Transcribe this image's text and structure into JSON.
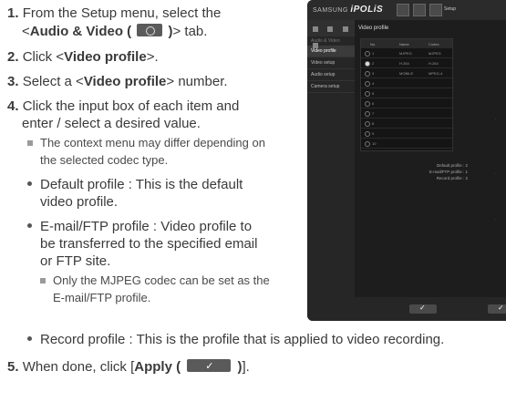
{
  "steps": [
    {
      "num": "1.",
      "pre": "From the Setup menu, select the",
      "line2_pre": "<",
      "bold": "Audio & Video (",
      "icon": "audio-video-icon",
      "bold_end": ")",
      "post": "> tab."
    },
    {
      "num": "2.",
      "pre": "Click <",
      "bold": "Video profile",
      "post": ">."
    },
    {
      "num": "3.",
      "pre": "Select a <",
      "bold": "Video profile",
      "post": "> number."
    },
    {
      "num": "4.",
      "line1": "Click the input box of each item and",
      "line2": "enter / select a desired value."
    },
    {
      "num": "5.",
      "pre": "When done, click [",
      "bold": "Apply (",
      "icon": "apply-check-icon",
      "bold_end": ")",
      "post": "]."
    }
  ],
  "notes": {
    "context_line1": "The context menu may differ depending on",
    "context_line2": "the selected codec type.",
    "mjpeg_line1": "Only the MJPEG codec can be set as the",
    "mjpeg_line2": "E-mail/FTP profile."
  },
  "bullets": {
    "default_line1": "Default profile : This is the default",
    "default_line2": "video profile.",
    "email_line1": "E-mail/FTP profile : Video profile to",
    "email_line2": "be transferred to the specified email",
    "email_line3": "or FTP site.",
    "record": "Record profile : This is the profile that is applied to video recording."
  },
  "screenshot": {
    "brand": "SAMSUNG",
    "product": "iPOLiS",
    "setup_label": "Setup",
    "sidebar_header": "Audio & Video",
    "sidebar_items": [
      "Video profile",
      "Video setup",
      "Audio setup",
      "Camera setup"
    ],
    "panel_title": "Video profile",
    "table_headers": [
      "No.",
      "Name",
      "Codec"
    ],
    "rows": [
      {
        "no": "1",
        "name": "MJPEG",
        "codec": "MJPEG",
        "selected": false
      },
      {
        "no": "2",
        "name": "H.264",
        "codec": "H.264",
        "selected": true
      },
      {
        "no": "3",
        "name": "MOBILE",
        "codec": "MPEG-4",
        "selected": false
      },
      {
        "no": "4",
        "name": "",
        "codec": "",
        "selected": false
      },
      {
        "no": "5",
        "name": "",
        "codec": "",
        "selected": false
      },
      {
        "no": "6",
        "name": "",
        "codec": "",
        "selected": false
      },
      {
        "no": "7",
        "name": "",
        "codec": "",
        "selected": false
      },
      {
        "no": "8",
        "name": "",
        "codec": "",
        "selected": false
      },
      {
        "no": "9",
        "name": "",
        "codec": "",
        "selected": false
      },
      {
        "no": "10",
        "name": "",
        "codec": "",
        "selected": false
      }
    ],
    "profile_labels": [
      "Default profile : 2",
      "E-mail/FTP profile : 1",
      "Record profile : 2"
    ]
  }
}
